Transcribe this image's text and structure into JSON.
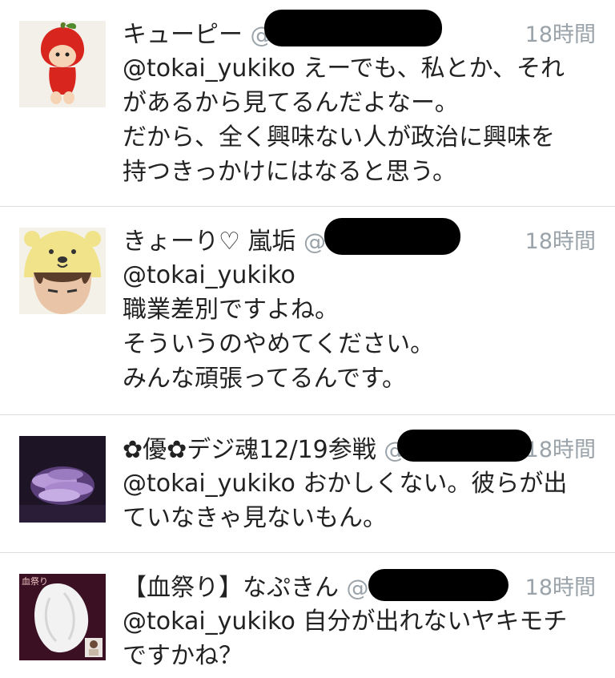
{
  "tweets": [
    {
      "name": "キューピー",
      "handle_fragment": "@",
      "time": "18時間",
      "lines": [
        "@tokai_yukiko えーでも、私とか、それ",
        "があるから見てるんだよなー。",
        "だから、全く興味ない人が政治に興味を",
        "持つきっかけにはなると思う。"
      ],
      "avatar_icon": "kewpie-apple-costume-avatar"
    },
    {
      "name": "きょーり♡ 嵐垢",
      "handle_fragment": "@",
      "time": "18時間",
      "lines": [
        "@tokai_yukiko",
        "職業差別ですよね。",
        "そういうのやめてください。",
        "みんな頑張ってるんです。"
      ],
      "avatar_icon": "person-bear-hat-avatar"
    },
    {
      "name": "✿優✿デジ魂12/19参戦",
      "handle_fragment": "@",
      "time": "18時間",
      "lines": [
        "@tokai_yukiko おかしくない。彼らが出",
        "ていなきゃ見ないもん。"
      ],
      "avatar_icon": "stacked-hands-avatar"
    },
    {
      "name": "【血祭り】なぷきん",
      "handle_fragment": "@",
      "time": "18時間",
      "lines": [
        "@tokai_yukiko 自分が出れないヤキモチ",
        "ですかね？"
      ],
      "avatar_icon": "napkin-avatar",
      "avatar_text": "血祭り"
    }
  ],
  "colors": {
    "text": "#222222",
    "muted": "#9aa3a9",
    "divider": "#d9dde0",
    "redaction": "#000000"
  }
}
